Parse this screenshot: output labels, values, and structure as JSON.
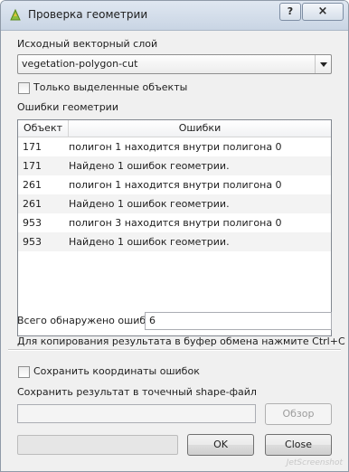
{
  "window": {
    "title": "Проверка геометрии",
    "help_label": "?",
    "close_label": "×"
  },
  "layer": {
    "label": "Исходный векторный слой",
    "selected": "vegetation-polygon-cut"
  },
  "only_selected": {
    "label": "Только выделенные объекты",
    "checked": false
  },
  "errors": {
    "label": "Ошибки геометрии",
    "columns": [
      "Объект",
      "Ошибки"
    ],
    "rows": [
      {
        "object": "171",
        "error": "полигон 1 находится внутри полигона 0"
      },
      {
        "object": "171",
        "error": "Найдено 1 ошибок геометрии."
      },
      {
        "object": "261",
        "error": "полигон 1 находится внутри полигона 0"
      },
      {
        "object": "261",
        "error": "Найдено 1 ошибок геометрии."
      },
      {
        "object": "953",
        "error": "полигон 3 находится внутри полигона 0"
      },
      {
        "object": "953",
        "error": "Найдено 1 ошибок геометрии."
      }
    ]
  },
  "total": {
    "label": "Всего обнаружено ошибок",
    "value": "6"
  },
  "copy_hint": "Для копирования результата в буфер обмена нажмите Ctrl+C",
  "save_coords": {
    "label": "Сохранить координаты ошибок",
    "checked": false
  },
  "save_shape": {
    "label": "Сохранить результат в точечный shape-файл",
    "path_value": "",
    "browse_label": "Обзор"
  },
  "progress": {
    "value": 0
  },
  "buttons": {
    "ok_label": "OK",
    "close_label": "Close"
  },
  "watermark": "JetScreenshot"
}
